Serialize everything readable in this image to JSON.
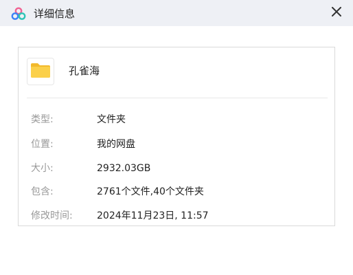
{
  "window": {
    "title": "详细信息",
    "logo_icon": "cloud-logo-icon",
    "close_icon": "close-icon"
  },
  "file": {
    "icon": "folder-icon",
    "name": "孔雀海"
  },
  "details": {
    "type_label": "类型:",
    "type_value": "文件夹",
    "location_label": "位置:",
    "location_value": "我的网盘",
    "size_label": "大小:",
    "size_value": "2932.03GB",
    "contains_label": "包含:",
    "contains_value": "2761个文件,40个文件夹",
    "modified_label": "修改时间:",
    "modified_value": "2024年11月23日, 11:57"
  },
  "colors": {
    "titlebar_bg": "#eef0f5",
    "folder_yellow": "#f6c63b",
    "logo_blue": "#3b82f6",
    "logo_pink": "#f06292",
    "logo_green": "#2ec4b6"
  }
}
